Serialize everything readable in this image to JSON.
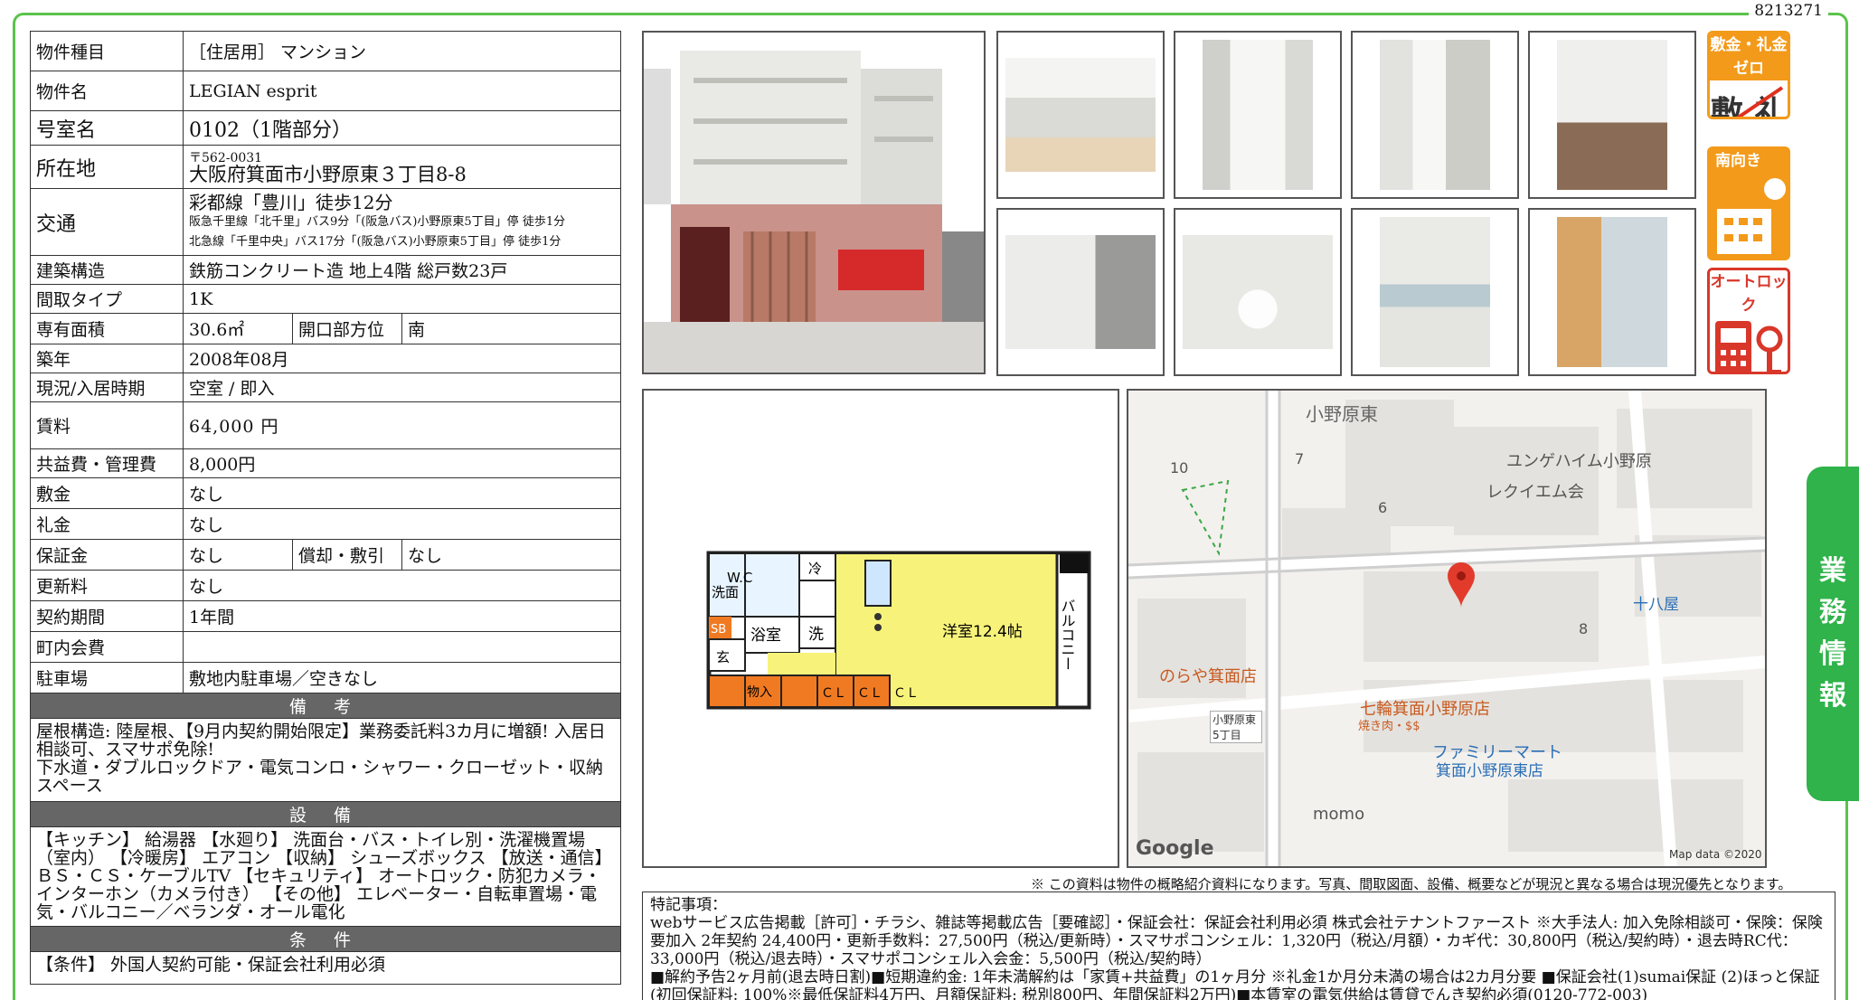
{
  "property_id": "8213271",
  "rows": {
    "type_label": "物件種目",
    "type_value": "［住居用］ マンション",
    "name_label": "物件名",
    "name_value": "LEGIAN esprit",
    "room_label": "号室名",
    "room_value": "0102（1階部分）",
    "address_label": "所在地",
    "address_zip": "〒562-0031",
    "address_value": "大阪府箕面市小野原東３丁目8-8",
    "access_label": "交通",
    "access_main": "彩都線「豊川」徒歩12分",
    "access_sub1": "阪急千里線「北千里」バス9分「(阪急バス)小野原東5丁目」停 徒歩1分",
    "access_sub2": "北急線「千里中央」バス17分「(阪急バス)小野原東5丁目」停 徒歩1分",
    "structure_label": "建築構造",
    "structure_value": "鉄筋コンクリート造 地上4階 総戸数23戸",
    "layout_label": "間取タイプ",
    "layout_value": "1K",
    "area_label": "専有面積",
    "area_value": "30.6㎡",
    "direction_label": "開口部方位",
    "direction_value": "南",
    "built_label": "築年",
    "built_value": "2008年08月",
    "status_label": "現況/入居時期",
    "status_value": "空室 / 即入",
    "rent_label": "賃料",
    "rent_value": "64,000 円",
    "fee_label": "共益費・管理費",
    "fee_value": "8,000円",
    "deposit_label": "敷金",
    "deposit_value": "なし",
    "keymoney_label": "礼金",
    "keymoney_value": "なし",
    "guarantee_label": "保証金",
    "guarantee_value": "なし",
    "amort_label": "償却・敷引",
    "amort_value": "なし",
    "renewal_label": "更新料",
    "renewal_value": "なし",
    "period_label": "契約期間",
    "period_value": "1年間",
    "town_label": "町内会費",
    "town_value": "",
    "parking_label": "駐車場",
    "parking_value": "敷地内駐車場／空きなし"
  },
  "remarks": {
    "title": "備 考",
    "text1": "屋根構造: 陸屋根、【9月内契約開始限定】業務委託料3カ月に増額! 入居日相談可、スマサポ免除!",
    "text2": "下水道・ダブルロックドア・電気コンロ・シャワー・クローゼット・収納スペース"
  },
  "equipment": {
    "title": "設 備",
    "text": "【キッチン】 給湯器 【水廻り】 洗面台・バス・トイレ別・洗濯機置場（室内） 【冷暖房】 エアコン 【収納】 シューズボックス 【放送・通信】 ＢＳ・ＣＳ・ケーブルTV 【セキュリティ】 オートロック・防犯カメラ・インターホン（カメラ付き） 【その他】 エレベーター・自転車置場・電気・バルコニー／ベランダ・オール電化"
  },
  "conditions": {
    "title": "条 件",
    "text": "【条件】 外国人契約可能・保証会社利用必須"
  },
  "badges": {
    "b1_title": "敷金・礼金ゼロ",
    "b1_glyph": "敷 礼",
    "b2_title": "南向き",
    "b3_title": "オートロック"
  },
  "side_tab": [
    "業",
    "務",
    "情",
    "報"
  ],
  "floorplan": {
    "wc": "W.C",
    "sen": "洗面",
    "sb": "SB",
    "genkan": "玄",
    "bath": "浴室",
    "laundry": "洗",
    "fridge": "冷",
    "room": "洋室12.4帖",
    "balcony": "バルコニー",
    "storage": "物入",
    "cl1": "ＣＬ",
    "cl2": "ＣＬ",
    "cl3": "ＣＬ"
  },
  "map": {
    "area": "小野原東",
    "n10": "10",
    "n7": "7",
    "n6": "6",
    "n8": "8",
    "poi1": "ユンゲハイム小野原",
    "poi2": "レクイエム会",
    "poi3": "十八屋",
    "poi4": "のらや箕面店",
    "poi5": "七輪箕面小野原店",
    "poi5b": "焼き肉・$$",
    "poi6": "ファミリーマート",
    "poi6b": "箕面小野原東店",
    "poi7": "momo",
    "stop": "小野原東5丁目",
    "google": "Google",
    "mapdata": "Map data ©2020"
  },
  "disclaimer": "※ この資料は物件の概略紹介資料になります。写真、間取図面、設備、概要などが現況と異なる場合は現況優先となります。",
  "special": {
    "title": "特記事項：",
    "line1": "webサービス広告掲載［許可］・チラシ、雑誌等掲載広告［要確認］・保証会社：保証会社利用必須 株式会社テナントファースト ※大手法人: 加入免除相談可・保険：保険要加入 2年契約 24,400円・更新手数料：27,500円（税込/更新時）・スマサポコンシェル：1,320円（税込/月額）・カギ代：30,800円（税込/契約時）・退去時RC代：33,000円（税込/退去時）・スマサポコンシェル入会金：5,500円（税込/契約時）",
    "line2": "■解約予告2ヶ月前(退去時日割)■短期違約金: 1年未満解約は「家賃+共益費」の1ヶ月分 ※礼金1か月分未満の場合は2カ月分要 ■保証会社(1)sumai保証 (2)ほっと保証(初回保証料: 100%※最低保証料4万円、月額保証料: 税別800円、年間保証料2万円)■本賃室の電気供給は賃貸でんき契約必須(0120-772-003)"
  }
}
